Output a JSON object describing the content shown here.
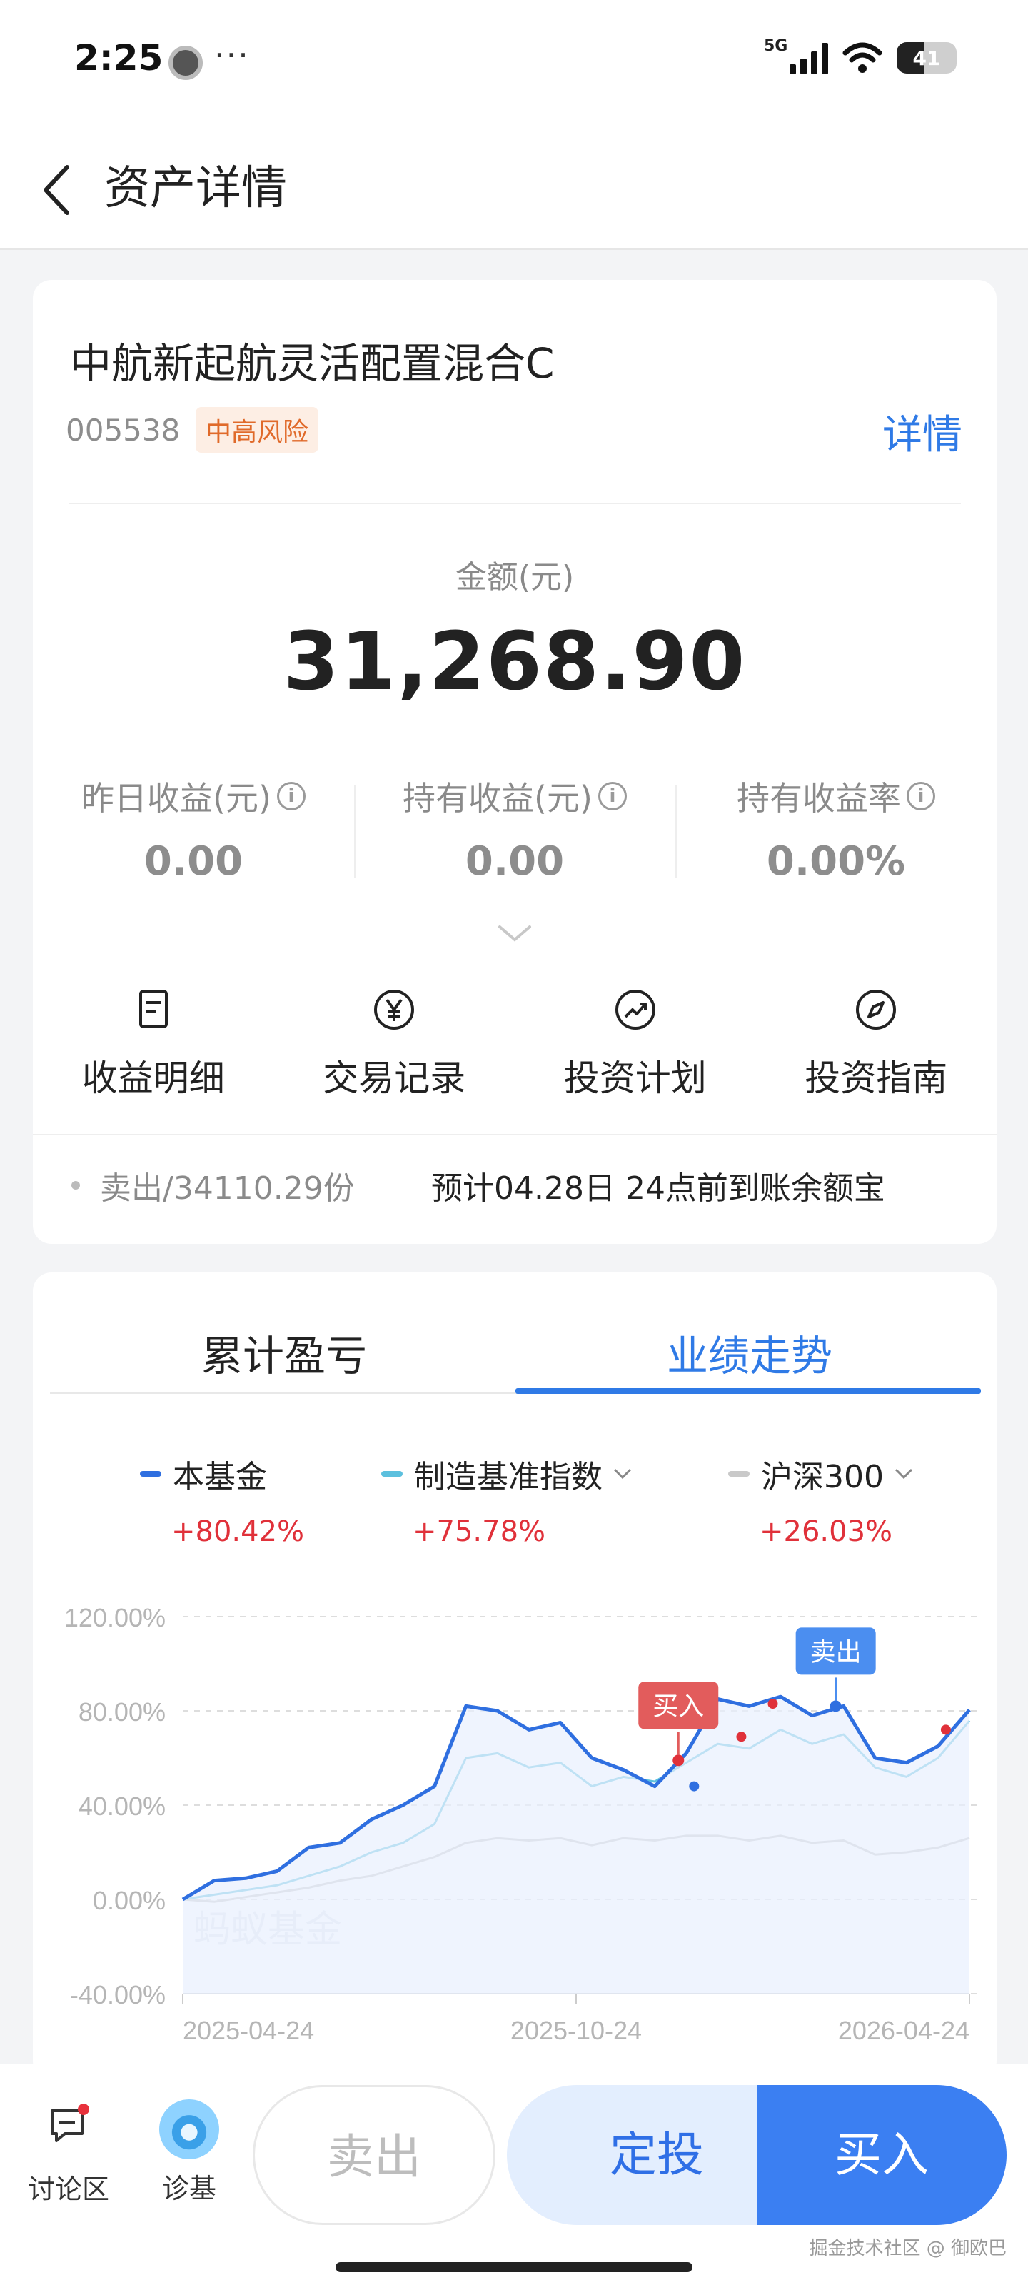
{
  "status": {
    "time": "2:25",
    "network": "5G",
    "battery": "41"
  },
  "nav": {
    "title": "资产详情"
  },
  "fund": {
    "name": "中航新起航灵活配置混合C",
    "code": "005538",
    "risk": "中高风险",
    "detail_link": "详情",
    "amount_label": "金额(元)",
    "amount": "31,268.90",
    "stats": [
      {
        "label": "昨日收益(元)",
        "value": "0.00"
      },
      {
        "label": "持有收益(元)",
        "value": "0.00"
      },
      {
        "label": "持有收益率",
        "value": "0.00%"
      }
    ],
    "actions": [
      {
        "label": "收益明细",
        "icon": "document-icon"
      },
      {
        "label": "交易记录",
        "icon": "yuan-icon"
      },
      {
        "label": "投资计划",
        "icon": "trend-icon"
      },
      {
        "label": "投资指南",
        "icon": "compass-icon"
      }
    ],
    "notice_left": "卖出/34110.29份",
    "notice_right": "预计04.28日 24点前到账余额宝"
  },
  "chart_tabs": [
    "累计盈亏",
    "业绩走势"
  ],
  "legend": [
    {
      "name": "本基金",
      "value": "+80.42%",
      "color": "#2f6fe0",
      "dropdown": false
    },
    {
      "name": "制造基准指数",
      "value": "+75.78%",
      "color": "#5cc0de",
      "dropdown": true
    },
    {
      "name": "沪深300",
      "value": "+26.03%",
      "color": "#c9c9c9",
      "dropdown": true
    }
  ],
  "chart_data": {
    "type": "line",
    "x_ticks": [
      "2025-04-24",
      "2025-10-24",
      "2026-04-24"
    ],
    "y_ticks": [
      "120.00%",
      "80.00%",
      "40.00%",
      "0.00%",
      "-40.00%"
    ],
    "ylim": [
      -40,
      120
    ],
    "x": [
      0,
      4,
      8,
      12,
      16,
      20,
      24,
      28,
      32,
      36,
      40,
      44,
      48,
      52,
      56,
      60,
      64,
      68,
      72,
      76,
      80,
      84,
      88,
      92,
      96,
      100
    ],
    "series": [
      {
        "name": "本基金",
        "color": "#2f6fe0",
        "values": [
          0,
          8,
          9,
          12,
          22,
          24,
          34,
          40,
          48,
          82,
          80,
          72,
          75,
          60,
          55,
          48,
          62,
          85,
          82,
          86,
          78,
          82,
          60,
          58,
          65,
          80.42
        ]
      },
      {
        "name": "制造基准指数",
        "color": "#5cc0de",
        "values": [
          0,
          2,
          4,
          6,
          10,
          14,
          20,
          24,
          32,
          60,
          62,
          56,
          58,
          48,
          52,
          50,
          58,
          66,
          64,
          72,
          66,
          70,
          56,
          52,
          60,
          75.78
        ]
      },
      {
        "name": "沪深300",
        "color": "#c9c9c9",
        "values": [
          0,
          -1,
          1,
          3,
          5,
          8,
          10,
          14,
          18,
          24,
          26,
          25,
          26,
          23,
          26,
          25,
          27,
          27,
          25,
          27,
          24,
          25,
          19,
          20,
          22,
          26.03
        ]
      }
    ],
    "markers": [
      {
        "label": "买入",
        "type": "buy",
        "x": 63,
        "y": 59
      },
      {
        "label": "卖出",
        "type": "sell",
        "x": 83,
        "y": 82
      }
    ],
    "extra_points": [
      {
        "type": "buy",
        "x": 71,
        "y": 69
      },
      {
        "type": "buy",
        "x": 75,
        "y": 83
      },
      {
        "type": "buy",
        "x": 97,
        "y": 72
      },
      {
        "type": "sell",
        "x": 65,
        "y": 48
      }
    ],
    "watermark": "蚂蚁基金"
  },
  "bottom": {
    "discuss": "讨论区",
    "diagnose": "诊基",
    "sell": "卖出",
    "sip": "定投",
    "buy": "买入",
    "watermark": "掘金技术社区 @ 御欧巴"
  }
}
